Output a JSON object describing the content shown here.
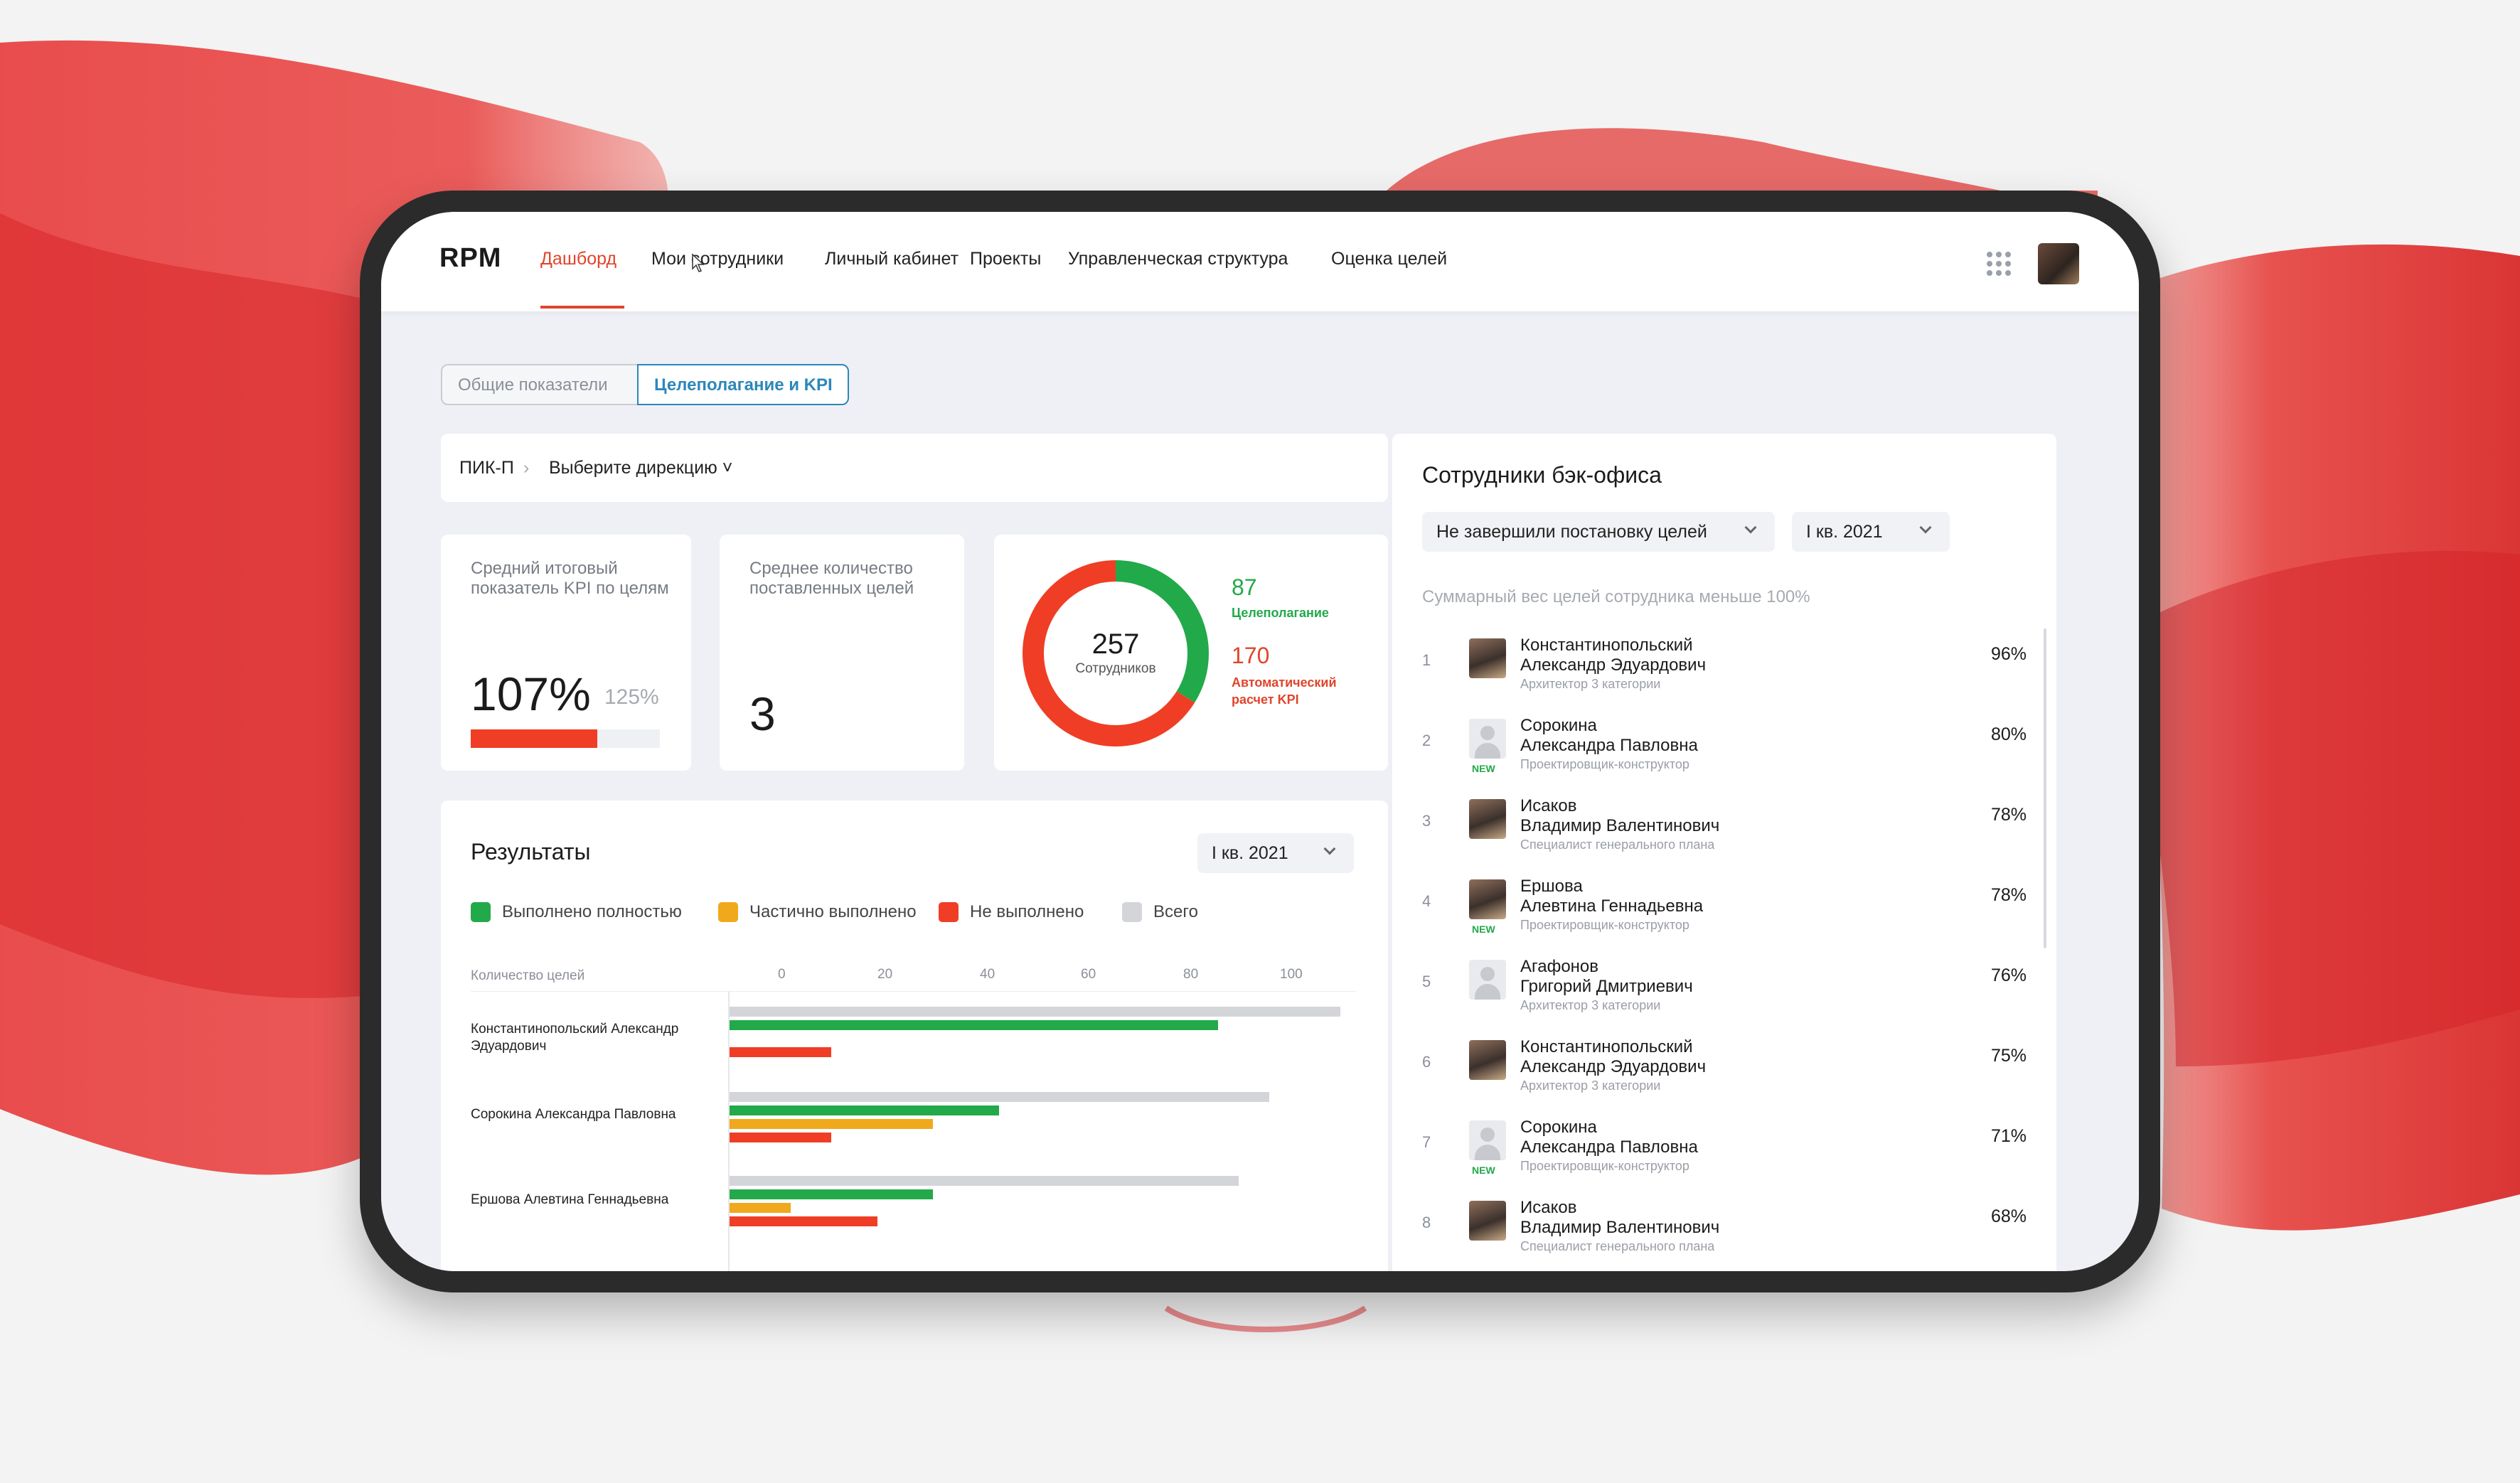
{
  "nav": {
    "logo": "RPM",
    "items": [
      "Дашборд",
      "Мои сотрудники",
      "Личный кабинет",
      "Проекты",
      "Управленческая структура",
      "Оценка целей"
    ],
    "active_index": 0
  },
  "tabs": {
    "general": "Общие показатели",
    "goals": "Целеполагание и KPI"
  },
  "breadcrumb": {
    "root": "ПИК-П",
    "separator": "›",
    "select": "Выберите дирекцию ˅"
  },
  "kpi_avg": {
    "label": "Средний итоговый показатель KPI по целям",
    "value": "107%",
    "target": "125%",
    "fill_fraction": 0.67
  },
  "kpi_goals": {
    "label": "Среднее количество поставленных целей",
    "value": "3"
  },
  "kpi_staff": {
    "total": "257",
    "total_label": "Сотрудников",
    "goal_setting_count": "87",
    "goal_setting_label": "Целеполагание",
    "auto_kpi_count": "170",
    "auto_kpi_label": "Автоматический расчет KPI"
  },
  "results": {
    "title": "Результаты",
    "period": "I кв. 2021",
    "legend": [
      "Выполнено полностью",
      "Частично выполнено",
      "Не выполнено",
      "Всего"
    ],
    "axis_label": "Количество целей",
    "ticks": [
      "0",
      "20",
      "40",
      "60",
      "80",
      "100"
    ]
  },
  "chart_data": {
    "type": "bar",
    "orientation": "horizontal",
    "xlim": [
      0,
      100
    ],
    "xlabel": "Количество целей",
    "categories": [
      "Константинопольский Александр Эдуардович",
      "Сорокина Александра Павловна",
      "Ершова Алевтина Геннадьевна"
    ],
    "series": [
      {
        "name": "Всего",
        "values": [
          120,
          106,
          100
        ]
      },
      {
        "name": "Выполнено полностью",
        "values": [
          96,
          53,
          40
        ]
      },
      {
        "name": "Частично выполнено",
        "values": [
          0,
          40,
          12
        ]
      },
      {
        "name": "Не выполнено",
        "values": [
          20,
          20,
          29
        ]
      }
    ],
    "colors": {
      "Всего": "#d3d5d9",
      "Выполнено полностью": "#22a94a",
      "Частично выполнено": "#f0a81c",
      "Не выполнено": "#ef3e25"
    }
  },
  "employees": {
    "title": "Сотрудники бэк-офиса",
    "filter": "Не завершили постановку целей",
    "period": "I кв. 2021",
    "note": "Суммарный вес целей сотрудника меньше 100%",
    "new_badge": "NEW",
    "rows": [
      {
        "idx": "1",
        "surname": "Константинопольский",
        "name": "Александр Эдуардович",
        "role": "Архитектор 3 категории",
        "pct": "96%",
        "photo": true,
        "new": false
      },
      {
        "idx": "2",
        "surname": "Сорокина",
        "name": "Александра Павловна",
        "role": "Проектировщик-конструктор",
        "pct": "80%",
        "photo": false,
        "new": true
      },
      {
        "idx": "3",
        "surname": "Исаков",
        "name": "Владимир Валентинович",
        "role": "Специалист генерального плана",
        "pct": "78%",
        "photo": true,
        "new": false
      },
      {
        "idx": "4",
        "surname": "Ершова",
        "name": "Алевтина Геннадьевна",
        "role": "Проектировщик-конструктор",
        "pct": "78%",
        "photo": true,
        "new": true
      },
      {
        "idx": "5",
        "surname": "Агафонов",
        "name": "Григорий Дмитриевич",
        "role": "Архитектор 3 категории",
        "pct": "76%",
        "photo": false,
        "new": false
      },
      {
        "idx": "6",
        "surname": "Константинопольский",
        "name": "Александр Эдуардович",
        "role": "Архитектор 3 категории",
        "pct": "75%",
        "photo": true,
        "new": false
      },
      {
        "idx": "7",
        "surname": "Сорокина",
        "name": "Александра Павловна",
        "role": "Проектировщик-конструктор",
        "pct": "71%",
        "photo": false,
        "new": true
      },
      {
        "idx": "8",
        "surname": "Исаков",
        "name": "Владимир Валентинович",
        "role": "Специалист генерального плана",
        "pct": "68%",
        "photo": true,
        "new": false
      }
    ]
  },
  "colors": {
    "accent": "#e0452b",
    "green": "#22a94a",
    "orange": "#f0a81c",
    "red": "#ef3e25",
    "gray": "#d3d5d9",
    "link_blue": "#2d87b8"
  }
}
